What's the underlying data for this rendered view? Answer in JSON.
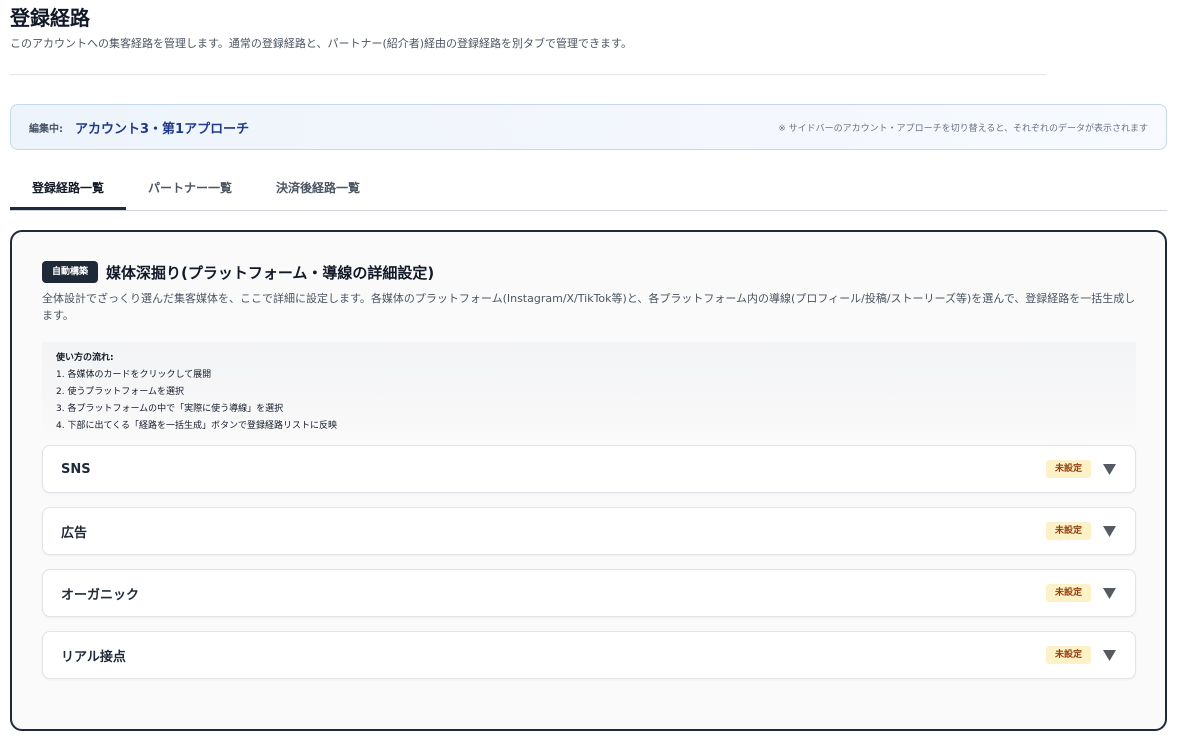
{
  "header": {
    "title": "登録経路",
    "description": "このアカウントへの集客経路を管理します。通常の登録経路と、パートナー(紹介者)経由の登録経路を別タブで管理できます。"
  },
  "banner": {
    "label": "編集中:",
    "value": "アカウント3・第1アプローチ",
    "note": "※ サイドバーのアカウント・アプローチを切り替えると、それぞれのデータが表示されます"
  },
  "tabs": [
    {
      "label": "登録経路一覧",
      "active": true
    },
    {
      "label": "パートナー一覧",
      "active": false
    },
    {
      "label": "決済後経路一覧",
      "active": false
    }
  ],
  "section": {
    "badge": "自動構築",
    "title": "媒体深掘り(プラットフォーム・導線の詳細設定)",
    "description": "全体設計でざっくり選んだ集客媒体を、ここで詳細に設定します。各媒体のプラットフォーム(Instagram/X/TikTok等)と、各プラットフォーム内の導線(プロフィール/投稿/ストーリーズ等)を選んで、登録経路を一括生成します。",
    "howto": {
      "title": "使い方の流れ:",
      "steps": [
        "1. 各媒体のカードをクリックして展開",
        "2. 使うプラットフォームを選択",
        "3. 各プラットフォームの中で「実際に使う導線」を選択",
        "4. 下部に出てくる「経路を一括生成」ボタンで登録経路リストに反映"
      ]
    },
    "categories": [
      {
        "name": "SNS",
        "status": "未設定"
      },
      {
        "name": "広告",
        "status": "未設定"
      },
      {
        "name": "オーガニック",
        "status": "未設定"
      },
      {
        "name": "リアル接点",
        "status": "未設定"
      }
    ]
  },
  "icons": {
    "chevron": "chevron-down-icon"
  },
  "colors": {
    "accent": "#1e3a8a",
    "badge_bg": "#1e2a38",
    "status_bg": "#fdf1c8",
    "status_text": "#92400e"
  }
}
